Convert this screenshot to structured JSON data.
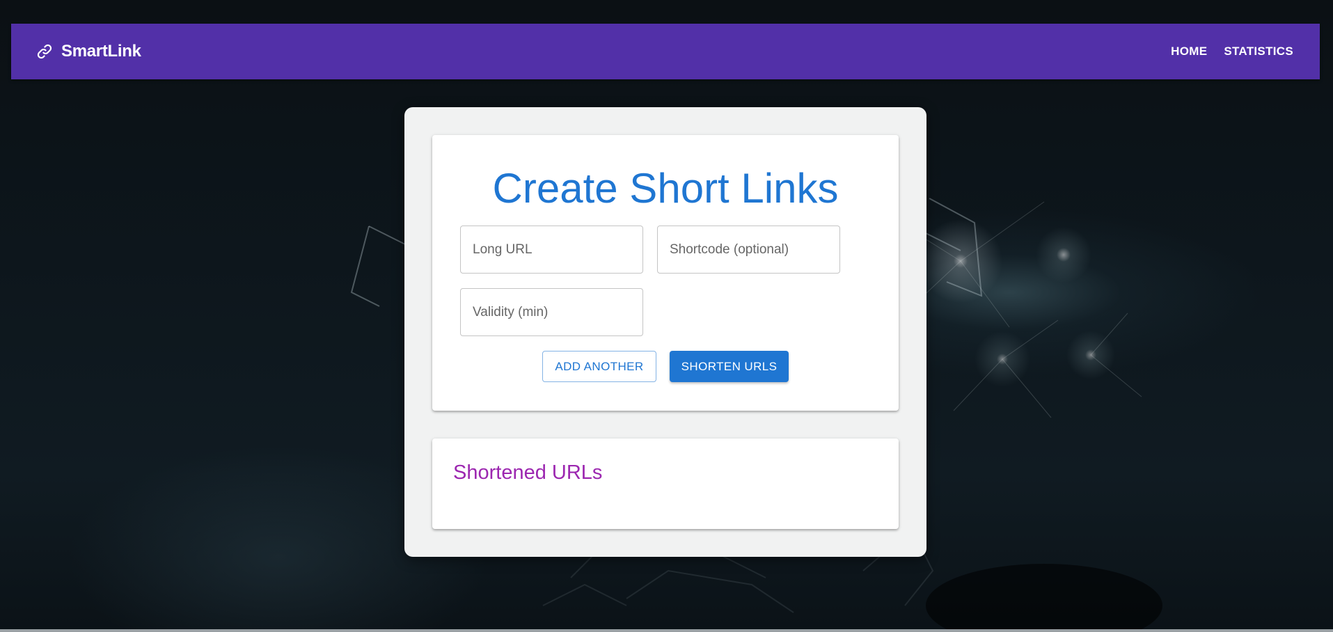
{
  "appbar": {
    "brand_icon": "link-icon",
    "brand_name": "SmartLink",
    "nav": [
      {
        "label": "HOME"
      },
      {
        "label": "STATISTICS"
      }
    ],
    "color": "#5230a8"
  },
  "form": {
    "title": "Create Short Links",
    "fields": {
      "long_url": {
        "placeholder": "Long URL",
        "value": ""
      },
      "shortcode": {
        "placeholder": "Shortcode (optional)",
        "value": ""
      },
      "validity": {
        "placeholder": "Validity (min)",
        "value": ""
      }
    },
    "buttons": {
      "add_another": "ADD ANOTHER",
      "shorten": "SHORTEN URLS"
    },
    "accent_color": "#1f76d2"
  },
  "results": {
    "title": "Shortened URLs",
    "title_color": "#9c27b0"
  }
}
